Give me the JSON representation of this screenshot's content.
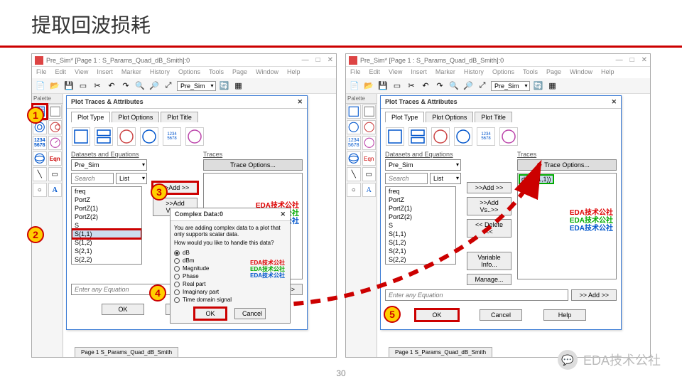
{
  "slide": {
    "title": "提取回波损耗",
    "page": "30"
  },
  "app": {
    "title": "Pre_Sim* [Page 1 : S_Params_Quad_dB_Smith]:0",
    "menus": [
      "File",
      "Edit",
      "View",
      "Insert",
      "Marker",
      "History",
      "Options",
      "Tools",
      "Page",
      "Window",
      "Help"
    ],
    "combo": "Pre_Sim",
    "palette_label": "Palette",
    "pagetab": "Page 1   S_Params_Quad_dB_Smith"
  },
  "dlg": {
    "title": "Plot Traces & Attributes",
    "tabs": [
      "Plot Type",
      "Plot Options",
      "Plot Title"
    ],
    "datasets_label": "Datasets and Equations",
    "dataset": "Pre_Sim",
    "search_ph": "Search",
    "list_label": "List",
    "traces_label": "Traces",
    "trace_options": "Trace Options...",
    "add": ">>Add >>",
    "addvs": ">>Add Vs..>>",
    "delete": "<< Delete <<",
    "varinfo": "Variable Info...",
    "manage": "Manage...",
    "enter_eq": "Enter any Equation",
    "eq_add": ">> Add >>",
    "ok": "OK",
    "cancel": "Cancel",
    "help": "Help",
    "items_left": [
      "freq",
      "PortZ",
      "PortZ(1)",
      "PortZ(2)",
      "S",
      "S(1,1)",
      "S(1,2)",
      "S(2,1)",
      "S(2,2)"
    ],
    "items_right": [
      "freq",
      "PortZ",
      "PortZ(1)",
      "PortZ(2)",
      "S",
      "S(1,1)",
      "S(1,2)",
      "S(2,1)",
      "S(2,2)"
    ],
    "trace_result": "dB(S(1,1))"
  },
  "subdlg": {
    "title": "Complex Data:0",
    "msg1": "You are adding complex data to a plot that only supports scalar data.",
    "msg2": "How would you like to handle this data?",
    "opts": [
      "dB",
      "dBm",
      "Magnitude",
      "Phase",
      "Real part",
      "Imaginary part",
      "Time domain signal"
    ],
    "ok": "OK",
    "cancel": "Cancel"
  },
  "watermark": {
    "r": "EDA技术公社",
    "g": "EDA技术公社",
    "b": "EDA技术公社"
  },
  "chat": "EDA技术公社"
}
